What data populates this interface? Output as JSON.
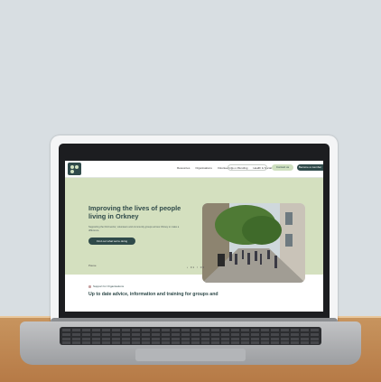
{
  "site": {
    "nav": [
      "Resources",
      "Organisations",
      "Volunteering",
      "Funding",
      "Health & Social Care",
      "Events"
    ],
    "search_placeholder": "Search",
    "contact_label": "Contact us",
    "member_label": "Become a member"
  },
  "hero": {
    "title": "Improving the lives of people living in Orkney",
    "subtitle": "Supporting the third sector, volunteers and community groups across Orkney to make a difference.",
    "cta_label": "Find out what we're doing",
    "pause_label": "Pause",
    "slider_indicator": "• 01 / 03"
  },
  "section": {
    "tag": "Support for Organisations",
    "heading": "Up to date advice, information and training for groups and"
  },
  "colors": {
    "brand_dark": "#2f4a4a",
    "brand_light": "#d4e0bf"
  }
}
